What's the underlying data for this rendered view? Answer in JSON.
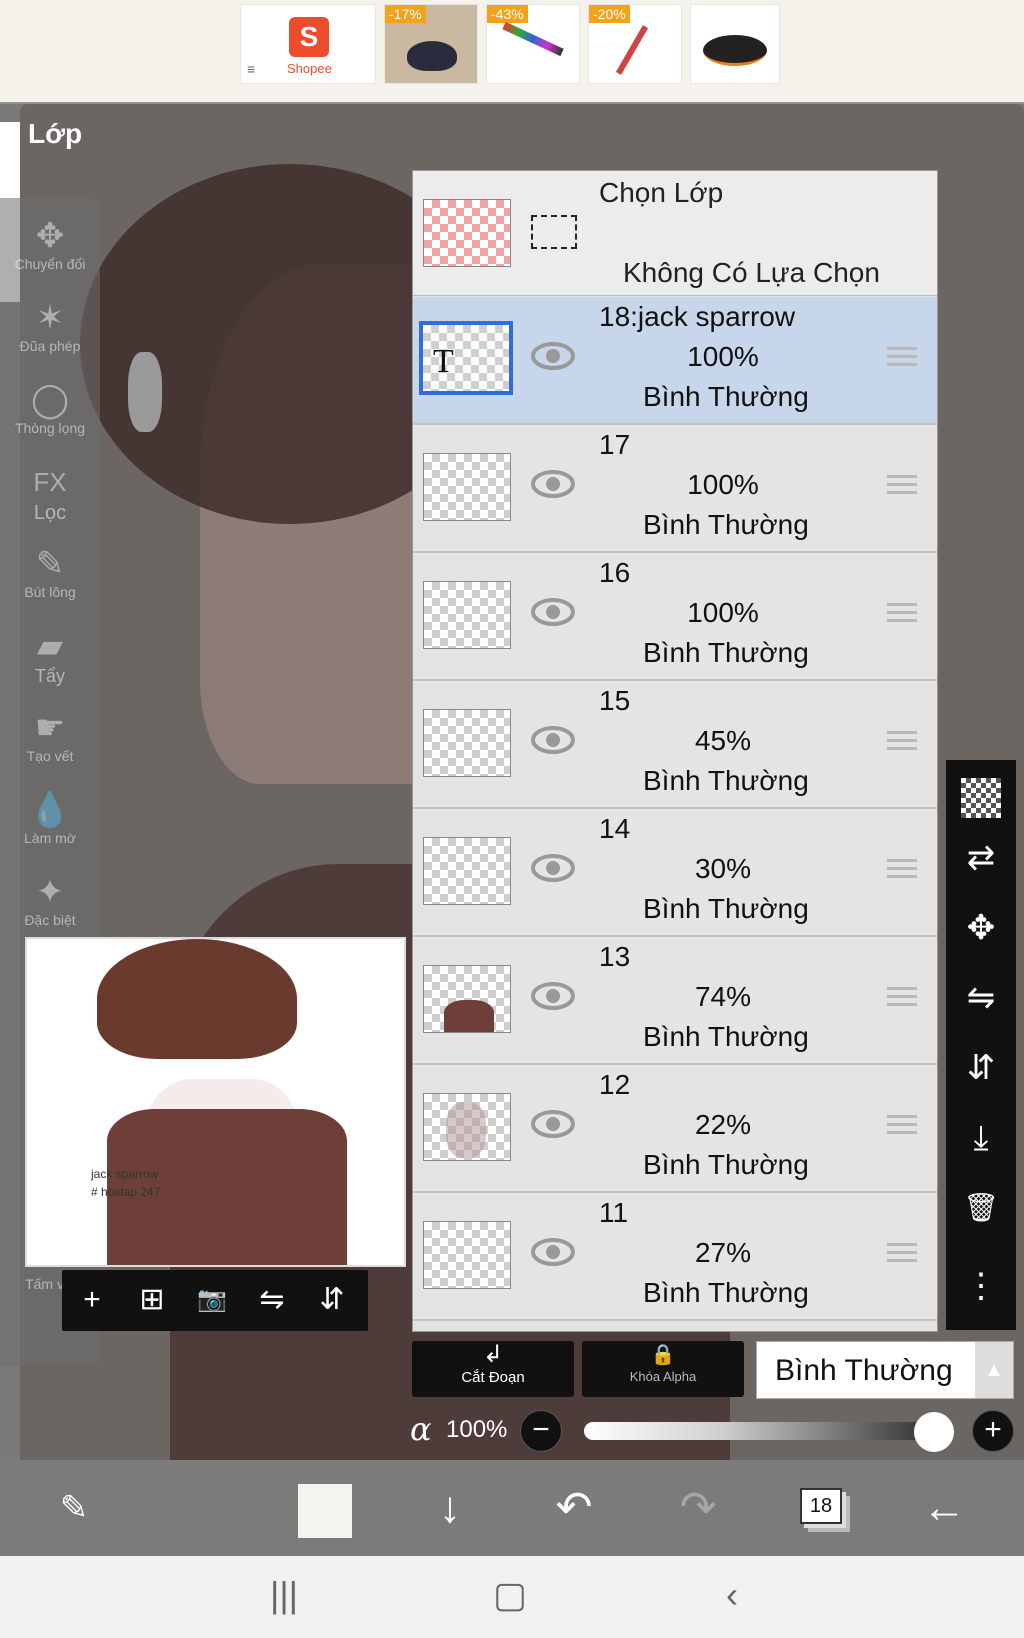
{
  "ad_bar": {
    "menu_icon": "≡",
    "shopee_label": "Shopee",
    "shopee_glyph": "S",
    "products": [
      {
        "badge": "-17%",
        "item": "mouse"
      },
      {
        "badge": "-43%",
        "item": "pens"
      },
      {
        "badge": "-20%",
        "item": "stylus"
      },
      {
        "badge": "",
        "item": "gaming-mouse"
      }
    ]
  },
  "panel_title": "Lớp",
  "tools": [
    {
      "label": "Chuyển đổi",
      "icon": "move-icon",
      "glyph": "✥"
    },
    {
      "label": "Đũa phép",
      "icon": "magic-wand-icon",
      "glyph": "✶"
    },
    {
      "label": "Thòng lọng",
      "icon": "lasso-icon",
      "glyph": "◯"
    },
    {
      "label": "Lọc",
      "icon": "fx-filter-icon",
      "glyph": "FX"
    },
    {
      "label": "Bút lông",
      "icon": "brush-icon",
      "glyph": "✎"
    },
    {
      "label": "Tẩy",
      "icon": "eraser-icon",
      "glyph": "▰"
    },
    {
      "label": "Tạo vết",
      "icon": "smudge-icon",
      "glyph": "☛"
    },
    {
      "label": "Làm mờ",
      "icon": "blur-icon",
      "glyph": "💧"
    },
    {
      "label": "Đặc biệt",
      "icon": "special-icon",
      "glyph": "✦"
    }
  ],
  "canvas_label": "Tấm vải",
  "preview": {
    "caption_line1": "jack sparrow",
    "caption_line2": "# hoidap 247"
  },
  "preview_tools": [
    {
      "name": "add-layer-icon",
      "glyph": "+"
    },
    {
      "name": "add-copy-icon",
      "glyph": "⊞"
    },
    {
      "name": "camera-icon",
      "glyph": "📷"
    },
    {
      "name": "flip-horizontal-icon",
      "glyph": "⇋"
    },
    {
      "name": "flip-vertical-icon",
      "glyph": "⇵"
    }
  ],
  "selection_row": {
    "title": "Chọn Lớp",
    "subtitle": "Không Có Lựa Chọn"
  },
  "layers": [
    {
      "name": "18:jack sparrow",
      "opacity": "100%",
      "blend": "Bình Thường",
      "selected": true,
      "is_text": true,
      "text_glyph": "T"
    },
    {
      "name": "17",
      "opacity": "100%",
      "blend": "Bình Thường",
      "selected": false
    },
    {
      "name": "16",
      "opacity": "100%",
      "blend": "Bình Thường",
      "selected": false
    },
    {
      "name": "15",
      "opacity": "45%",
      "blend": "Bình Thường",
      "selected": false
    },
    {
      "name": "14",
      "opacity": "30%",
      "blend": "Bình Thường",
      "selected": false
    },
    {
      "name": "13",
      "opacity": "74%",
      "blend": "Bình Thường",
      "selected": false
    },
    {
      "name": "12",
      "opacity": "22%",
      "blend": "Bình Thường",
      "selected": false
    },
    {
      "name": "11",
      "opacity": "27%",
      "blend": "Bình Thường",
      "selected": false
    }
  ],
  "right_tools": [
    {
      "name": "transparency-icon",
      "glyph": ""
    },
    {
      "name": "swap-layer-icon",
      "glyph": "⇄"
    },
    {
      "name": "move-layer-icon",
      "glyph": "✥"
    },
    {
      "name": "flip-h-layer-icon",
      "glyph": "⇋"
    },
    {
      "name": "flip-v-layer-icon",
      "glyph": "⇵"
    },
    {
      "name": "merge-down-icon",
      "glyph": "⤓"
    },
    {
      "name": "trash-icon",
      "glyph": "🗑"
    },
    {
      "name": "more-icon",
      "glyph": "⋮"
    }
  ],
  "bottom_controls": {
    "clip_label": "Cắt Đoạn",
    "clip_icon": "↲",
    "alpha_lock_label": "Khóa Alpha",
    "alpha_lock_icon": "🔒",
    "blend_mode": "Bình Thường",
    "blend_arrow": "▲",
    "alpha_symbol": "α",
    "alpha_value": "100%",
    "alpha_fraction": 1.0,
    "minus": "−",
    "plus": "+"
  },
  "app_bar": {
    "layer_count_badge": "18",
    "current_color": "#f5f3ee"
  }
}
